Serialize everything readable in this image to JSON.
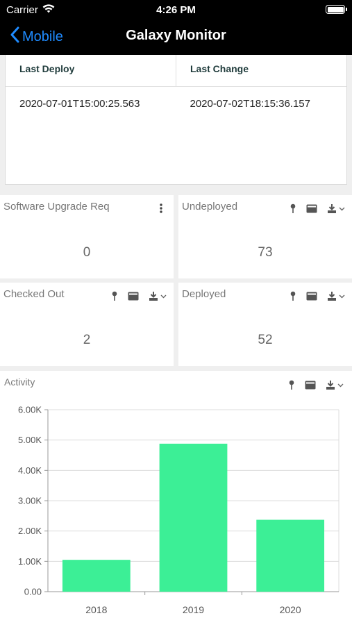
{
  "status_bar": {
    "carrier": "Carrier",
    "time": "4:26 PM"
  },
  "nav": {
    "back_label": "Mobile",
    "title": "Galaxy Monitor"
  },
  "deploy_table": {
    "headers": [
      "Last Deploy",
      "Last Change"
    ],
    "row": [
      "2020-07-01T15:00:25.563",
      "2020-07-02T18:15:36.157"
    ]
  },
  "tiles": {
    "software_upgrade": {
      "title": "Software Upgrade Req",
      "value": "0"
    },
    "undeployed": {
      "title": "Undeployed",
      "value": "73"
    },
    "checked_out": {
      "title": "Checked Out",
      "value": "2"
    },
    "deployed": {
      "title": "Deployed",
      "value": "52"
    }
  },
  "activity": {
    "title": "Activity"
  },
  "chart_data": {
    "type": "bar",
    "categories": [
      "2018",
      "2019",
      "2020"
    ],
    "values": [
      1050,
      4880,
      2370
    ],
    "ylim": [
      0,
      6000
    ],
    "yticks": [
      "0.00",
      "1.00K",
      "2.00K",
      "3.00K",
      "4.00K",
      "5.00K",
      "6.00K"
    ],
    "bar_color": "#3cef96",
    "grid": true
  },
  "colors": {
    "accent": "#1f8bff",
    "bar": "#3cef96"
  },
  "icons": [
    "wifi-icon",
    "battery-icon",
    "chevron-left-icon",
    "more-vertical-icon",
    "pin-icon",
    "card-icon",
    "download-icon",
    "chevron-down-icon"
  ]
}
